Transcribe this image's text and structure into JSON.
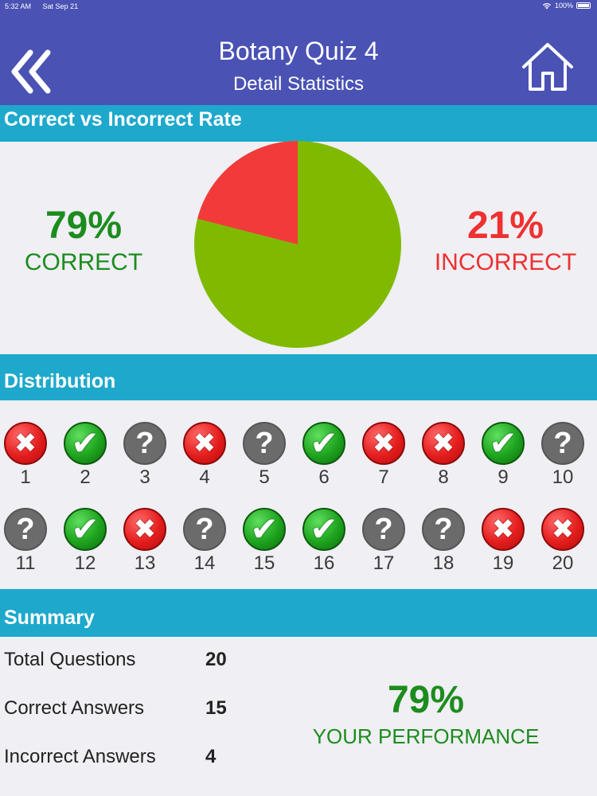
{
  "status": {
    "time": "5:32 AM",
    "date": "Sat Sep 21",
    "battery": "100%"
  },
  "header": {
    "title": "Botany Quiz 4",
    "subtitle": "Detail Statistics"
  },
  "sections": {
    "rate": "Correct vs Incorrect Rate",
    "distribution": "Distribution",
    "summary": "Summary"
  },
  "rate": {
    "correct_pct": "79%",
    "correct_label": "CORRECT",
    "incorrect_pct": "21%",
    "incorrect_label": "INCORRECT",
    "correct_fraction": 0.79
  },
  "distribution": [
    {
      "n": "1",
      "s": "wrong"
    },
    {
      "n": "2",
      "s": "right"
    },
    {
      "n": "3",
      "s": "none"
    },
    {
      "n": "4",
      "s": "wrong"
    },
    {
      "n": "5",
      "s": "none"
    },
    {
      "n": "6",
      "s": "right"
    },
    {
      "n": "7",
      "s": "wrong"
    },
    {
      "n": "8",
      "s": "wrong"
    },
    {
      "n": "9",
      "s": "right"
    },
    {
      "n": "10",
      "s": "none"
    },
    {
      "n": "11",
      "s": "none"
    },
    {
      "n": "12",
      "s": "right"
    },
    {
      "n": "13",
      "s": "wrong"
    },
    {
      "n": "14",
      "s": "none"
    },
    {
      "n": "15",
      "s": "right"
    },
    {
      "n": "16",
      "s": "right"
    },
    {
      "n": "17",
      "s": "none"
    },
    {
      "n": "18",
      "s": "none"
    },
    {
      "n": "19",
      "s": "wrong"
    },
    {
      "n": "20",
      "s": "wrong"
    }
  ],
  "summary": {
    "total_label": "Total Questions",
    "total_value": "20",
    "correct_label": "Correct Answers",
    "correct_value": "15",
    "incorrect_label": "Incorrect Answers",
    "incorrect_value": "4",
    "performance_pct": "79%",
    "performance_label": "YOUR PERFORMANCE"
  },
  "colors": {
    "header": "#4a52b4",
    "section": "#1ea8cc",
    "green": "#1d8c1e",
    "red": "#ee3131",
    "pie_green": "#7fba00",
    "pie_red": "#f23a3a"
  }
}
